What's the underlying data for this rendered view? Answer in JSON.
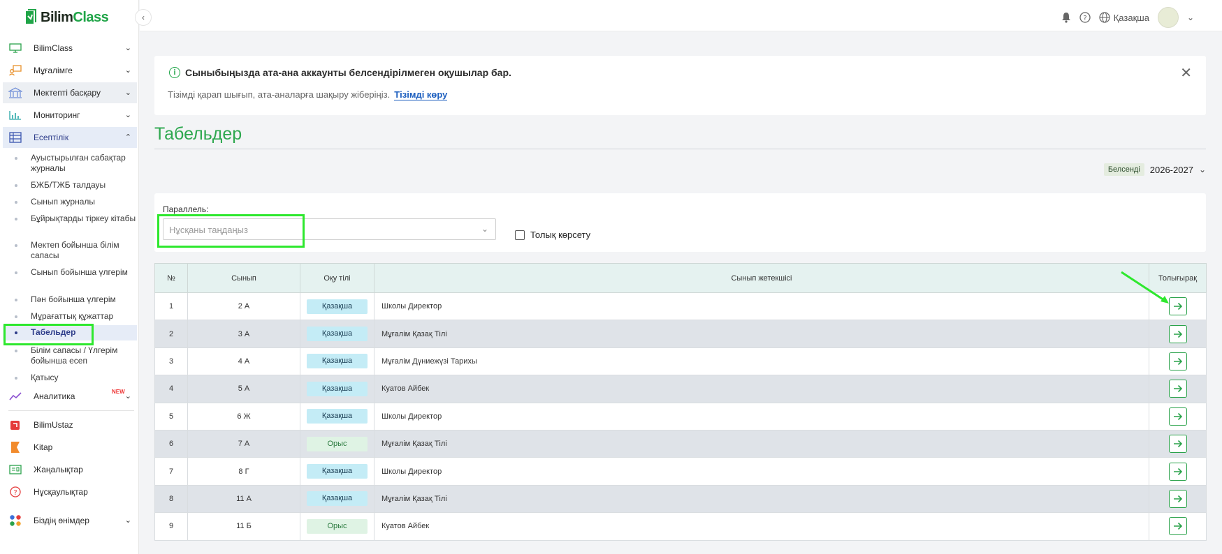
{
  "brand": {
    "name_a": "Bilim",
    "name_b": "Class"
  },
  "sidebar": {
    "items": [
      {
        "label": "BilimClass"
      },
      {
        "label": "Мұғалімге"
      },
      {
        "label": "Мектепті басқару"
      },
      {
        "label": "Мониторинг"
      },
      {
        "label": "Есептілік"
      }
    ],
    "sub_items": [
      {
        "label": "Ауыстырылған сабақтар журналы"
      },
      {
        "label": "БЖБ/ТЖБ талдауы"
      },
      {
        "label": "Сынып журналы"
      },
      {
        "label": "Бұйрықтарды тіркеу кітабы"
      },
      {
        "label": "Мектеп бойынша білім сапасы"
      },
      {
        "label": "Сынып бойынша үлгерім"
      },
      {
        "label": "Пән бойынша үлгерім"
      },
      {
        "label": "Мұрағаттық құжаттар"
      },
      {
        "label": "Табельдер"
      },
      {
        "label": "Білім сапасы / Үлгерім бойынша есеп"
      },
      {
        "label": "Қатысу"
      }
    ],
    "analytics": {
      "label": "Аналитика",
      "badge": "NEW"
    },
    "bottom_items": [
      {
        "label": "BilimUstaz"
      },
      {
        "label": "Kitap"
      },
      {
        "label": "Жаңалықтар"
      },
      {
        "label": "Нұсқаулықтар"
      },
      {
        "label": "Біздің өнімдер"
      }
    ]
  },
  "topbar": {
    "language": "Қазақша"
  },
  "alert": {
    "title": "Сыныбыңызда ата-ана аккаунты белсендірілмеген оқушылар бар.",
    "text": "Тізімді қарап шығып, ата-аналарға шақыру жіберіңіз.",
    "link": "Тізімді көру"
  },
  "page": {
    "title": "Табельдер"
  },
  "year": {
    "status": "Белсенді",
    "value": "2026-2027"
  },
  "filter": {
    "label": "Параллель:",
    "placeholder": "Нұсқаны таңдаңыз",
    "checkbox_label": "Толық көрсету"
  },
  "table": {
    "headers": [
      "№",
      "Сынып",
      "Оқу тілі",
      "Сынып жетекшісі",
      "Толығырақ"
    ],
    "rows": [
      {
        "n": "1",
        "cls": "2 А",
        "lang": "Қазақша",
        "lang_type": "kz",
        "teacher": "Школы Директор"
      },
      {
        "n": "2",
        "cls": "3 А",
        "lang": "Қазақша",
        "lang_type": "kz",
        "teacher": "Мұғалім Қазақ Тілі"
      },
      {
        "n": "3",
        "cls": "4 А",
        "lang": "Қазақша",
        "lang_type": "kz",
        "teacher": "Мұғалім Дүниежүзі Тарихы"
      },
      {
        "n": "4",
        "cls": "5 А",
        "lang": "Қазақша",
        "lang_type": "kz",
        "teacher": "Куатов Айбек"
      },
      {
        "n": "5",
        "cls": "6 Ж",
        "lang": "Қазақша",
        "lang_type": "kz",
        "teacher": "Школы Директор"
      },
      {
        "n": "6",
        "cls": "7 А",
        "lang": "Орыс",
        "lang_type": "ru",
        "teacher": "Мұғалім Қазақ Тілі"
      },
      {
        "n": "7",
        "cls": "8 Г",
        "lang": "Қазақша",
        "lang_type": "kz",
        "teacher": "Школы Директор"
      },
      {
        "n": "8",
        "cls": "11 А",
        "lang": "Қазақша",
        "lang_type": "kz",
        "teacher": "Мұғалім Қазақ Тілі"
      },
      {
        "n": "9",
        "cls": "11 Б",
        "lang": "Орыс",
        "lang_type": "ru",
        "teacher": "Куатов Айбек"
      }
    ]
  },
  "colors": {
    "accent": "#2ea84f",
    "link": "#1d5fbf",
    "annotation": "#2ee82e"
  }
}
